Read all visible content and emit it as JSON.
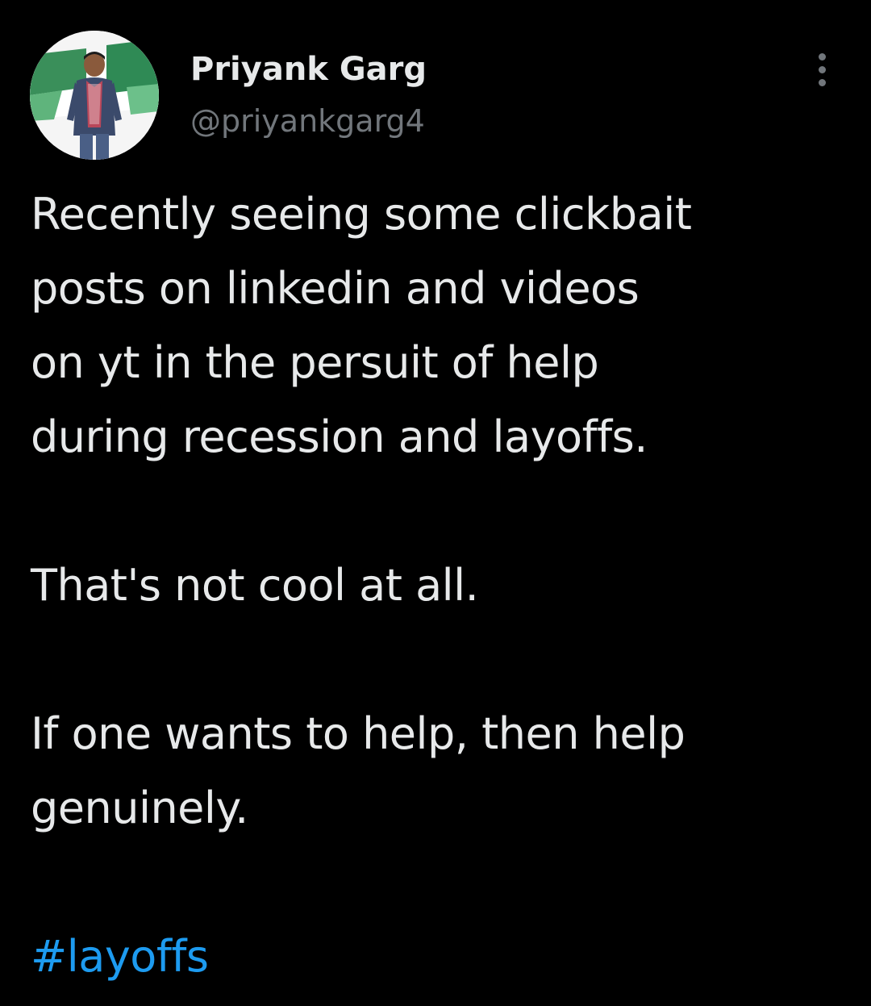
{
  "author": {
    "name": "Priyank Garg",
    "handle": "@priyankgarg4"
  },
  "tweet": {
    "line1": "Recently seeing some clickbait",
    "line2": "posts on linkedin and videos",
    "line3": "on yt in the persuit of help",
    "line4": "during recession and layoffs.",
    "line5": "That's not cool at all.",
    "line6": "If one wants to help, then help",
    "line7": "genuinely.",
    "hashtag": "#layoffs"
  },
  "icons": {
    "more": "more-vertical-icon"
  },
  "colors": {
    "background": "#000000",
    "text": "#e7e9ea",
    "secondary": "#71767b",
    "link": "#1d9bf0"
  }
}
